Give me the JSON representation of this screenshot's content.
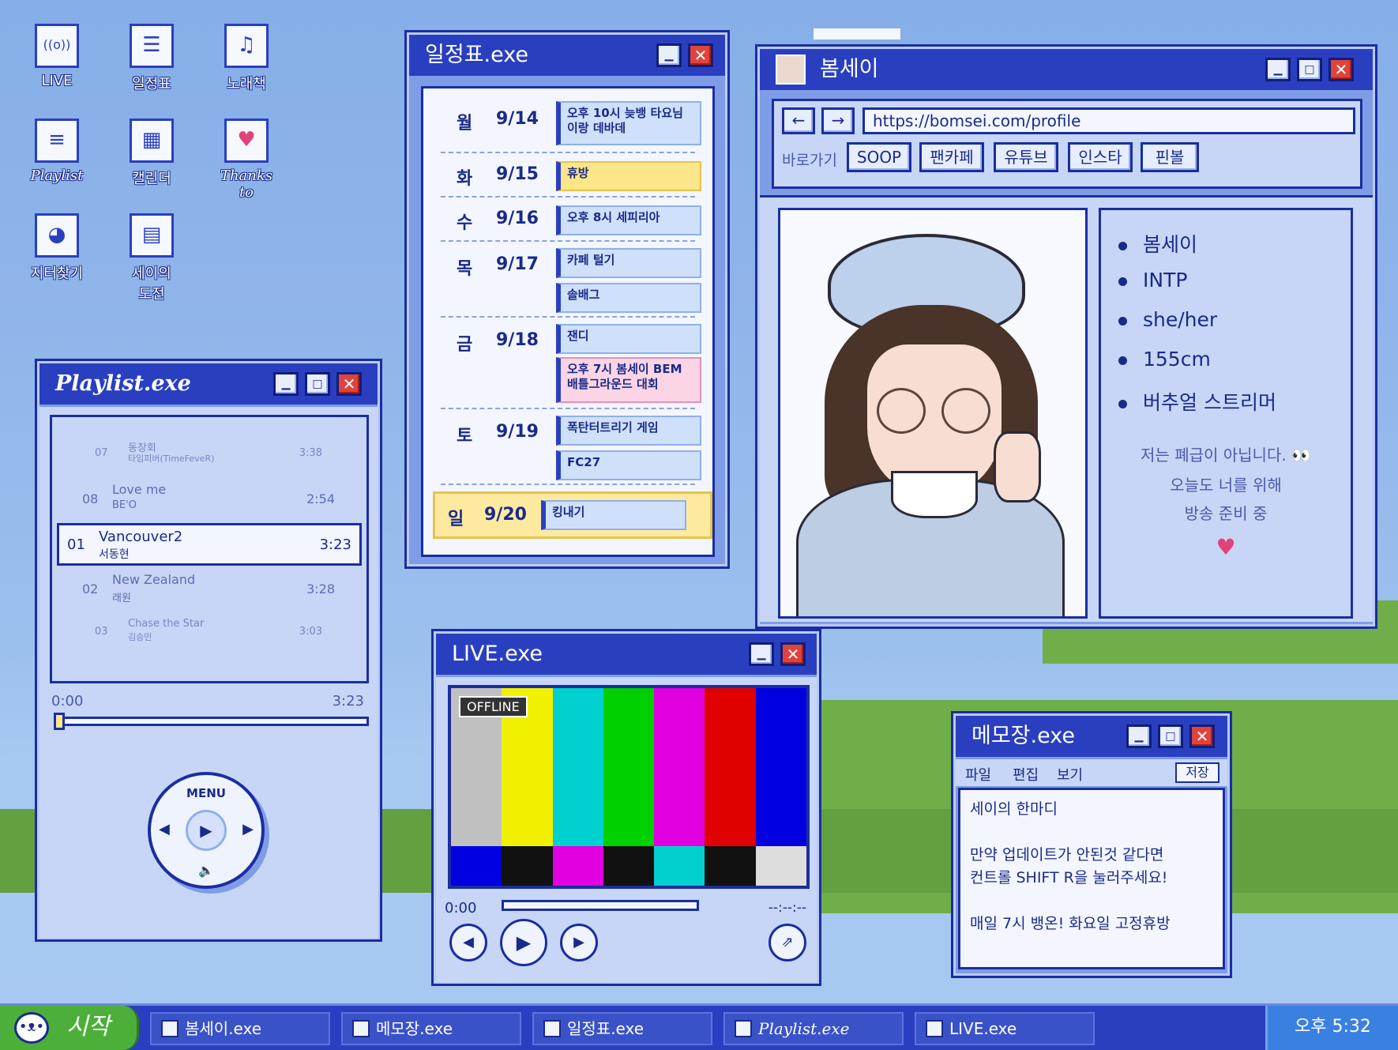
{
  "desktop": {
    "icons": [
      {
        "label": "LIVE",
        "glyph": "((o))",
        "icon": "broadcast-icon"
      },
      {
        "label": "일정표",
        "glyph": "☰",
        "icon": "schedule-icon"
      },
      {
        "label": "노래책",
        "glyph": "♫",
        "icon": "songbook-icon"
      },
      {
        "label": "Playlist",
        "glyph": "≡",
        "icon": "playlist-icon"
      },
      {
        "label": "캘린더",
        "glyph": "▦",
        "icon": "calendar-icon"
      },
      {
        "label": "Thanks to",
        "glyph": "♥",
        "icon": "thanks-icon"
      },
      {
        "label": "지터찾기",
        "glyph": "◕",
        "icon": "dog-icon"
      },
      {
        "label": "세이의 도전",
        "glyph": "▤",
        "icon": "challenge-icon"
      }
    ]
  },
  "schedule": {
    "title": "일정표.exe",
    "days": [
      {
        "day": "월",
        "date": "9/14",
        "events": [
          "오후 10시 늦뱅 타요님이랑 데바데"
        ]
      },
      {
        "day": "화",
        "date": "9/15",
        "events": [
          "휴방"
        ]
      },
      {
        "day": "수",
        "date": "9/16",
        "events": [
          "오후 8시 세피리아"
        ]
      },
      {
        "day": "목",
        "date": "9/17",
        "events": [
          "카페 털기",
          "솔배그"
        ]
      },
      {
        "day": "금",
        "date": "9/18",
        "events": [
          "잰디",
          "오후 7시 봄세이 BEM 배틀그라운드 대회"
        ]
      },
      {
        "day": "토",
        "date": "9/19",
        "events": [
          "폭탄터트리기 게임",
          "FC27"
        ]
      },
      {
        "day": "일",
        "date": "9/20",
        "events": [
          "킹내기"
        ]
      }
    ]
  },
  "profile": {
    "title": "봄세이",
    "url": "https://bomsei.com/profile",
    "shortcut_label": "바로가기",
    "shortcuts": [
      "SOOP",
      "팬카페",
      "유튜브",
      "인스타",
      "핀볼"
    ],
    "facts": [
      "봄세이",
      "INTP",
      "she/her",
      "155cm",
      "버추얼 스트리머"
    ],
    "bio": [
      "저는 폐급이 아닙니다. 👀",
      "오늘도 너를 위해",
      "방송 준비 중"
    ],
    "heart": "♥"
  },
  "playlist": {
    "title": "Playlist.exe",
    "tracks": [
      {
        "num": "07",
        "title": "동창회",
        "artist": "타임피버(TimeFeveR)",
        "duration": "3:38"
      },
      {
        "num": "08",
        "title": "Love me",
        "artist": "BE'O",
        "duration": "2:54"
      },
      {
        "num": "01",
        "title": "Vancouver2",
        "artist": "서동현",
        "duration": "3:23"
      },
      {
        "num": "02",
        "title": "New Zealand",
        "artist": "래원",
        "duration": "3:28"
      },
      {
        "num": "03",
        "title": "Chase the Star",
        "artist": "김승민",
        "duration": "3:03"
      }
    ],
    "current_time": "0:00",
    "total_time": "3:23",
    "progress": 0,
    "menu_label": "MENU"
  },
  "live": {
    "title": "LIVE.exe",
    "status": "OFFLINE",
    "current_time": "0:00",
    "end_time": "--:--:--",
    "bars": [
      "#c0c0c0",
      "#f0f000",
      "#00d0d0",
      "#00d000",
      "#e000e0",
      "#e00000",
      "#0000e0"
    ],
    "bottom_bars": [
      "#0000e0",
      "#111111",
      "#e000e0",
      "#111111",
      "#00d0d0",
      "#111111",
      "#dddddd"
    ]
  },
  "memo": {
    "title": "메모장.exe",
    "menu": [
      "파일",
      "편집",
      "보기"
    ],
    "save_label": "저장",
    "lines": [
      "세이의 한마디",
      "",
      "만약 업데이트가 안된것 같다면",
      "컨트롤 SHIFT R을 눌러주세요!",
      "",
      "매일 7시 뱅온! 화요일 고정휴방"
    ]
  },
  "taskbar": {
    "start_label": "시작",
    "items": [
      "봄세이.exe",
      "메모장.exe",
      "일정표.exe",
      "Playlist.exe",
      "LIVE.exe"
    ],
    "clock": "오후 5:32"
  }
}
